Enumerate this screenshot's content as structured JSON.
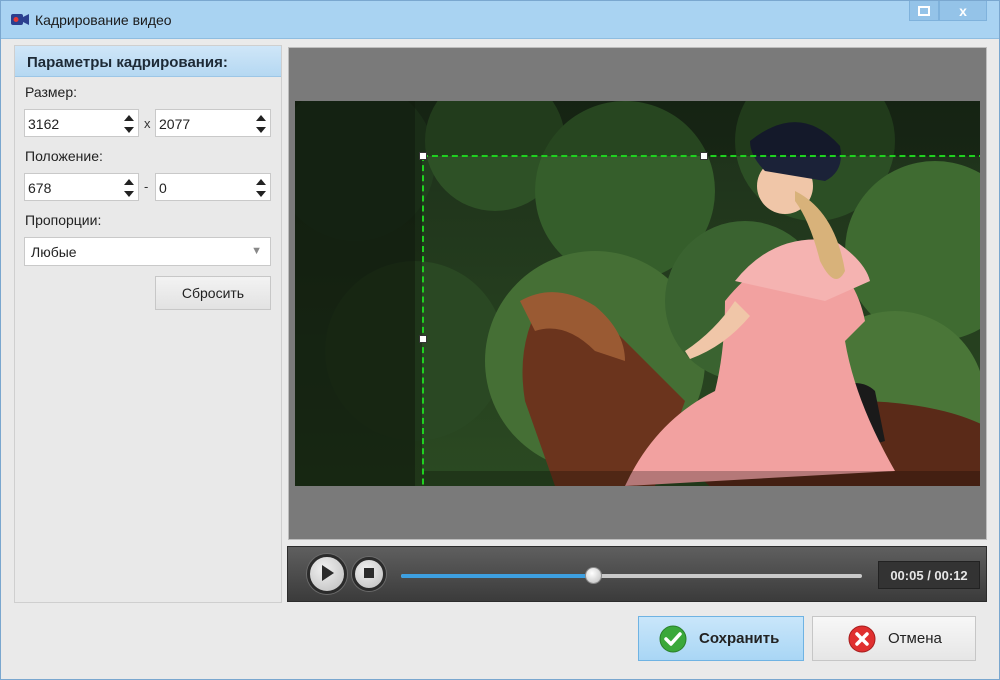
{
  "window": {
    "title": "Кадрирование видео",
    "maximize_glyph": "□",
    "close_glyph": "x"
  },
  "panel": {
    "header": "Параметры кадрирования:",
    "size_label": "Размер:",
    "width": "3162",
    "size_separator": "x",
    "height": "2077",
    "position_label": "Положение:",
    "pos_x": "678",
    "position_separator": "-",
    "pos_y": "0",
    "aspect_label": "Пропорции:",
    "aspect_value": "Любые",
    "reset_label": "Сбросить"
  },
  "player": {
    "progress": 0.4167,
    "time": "00:05 / 00:12"
  },
  "actions": {
    "save_label": "Сохранить",
    "cancel_label": "Отмена"
  },
  "colors": {
    "crop_border": "#1fd11f",
    "progress_fill": "#3d9fe0",
    "titlebar": "#a9d3f2"
  }
}
